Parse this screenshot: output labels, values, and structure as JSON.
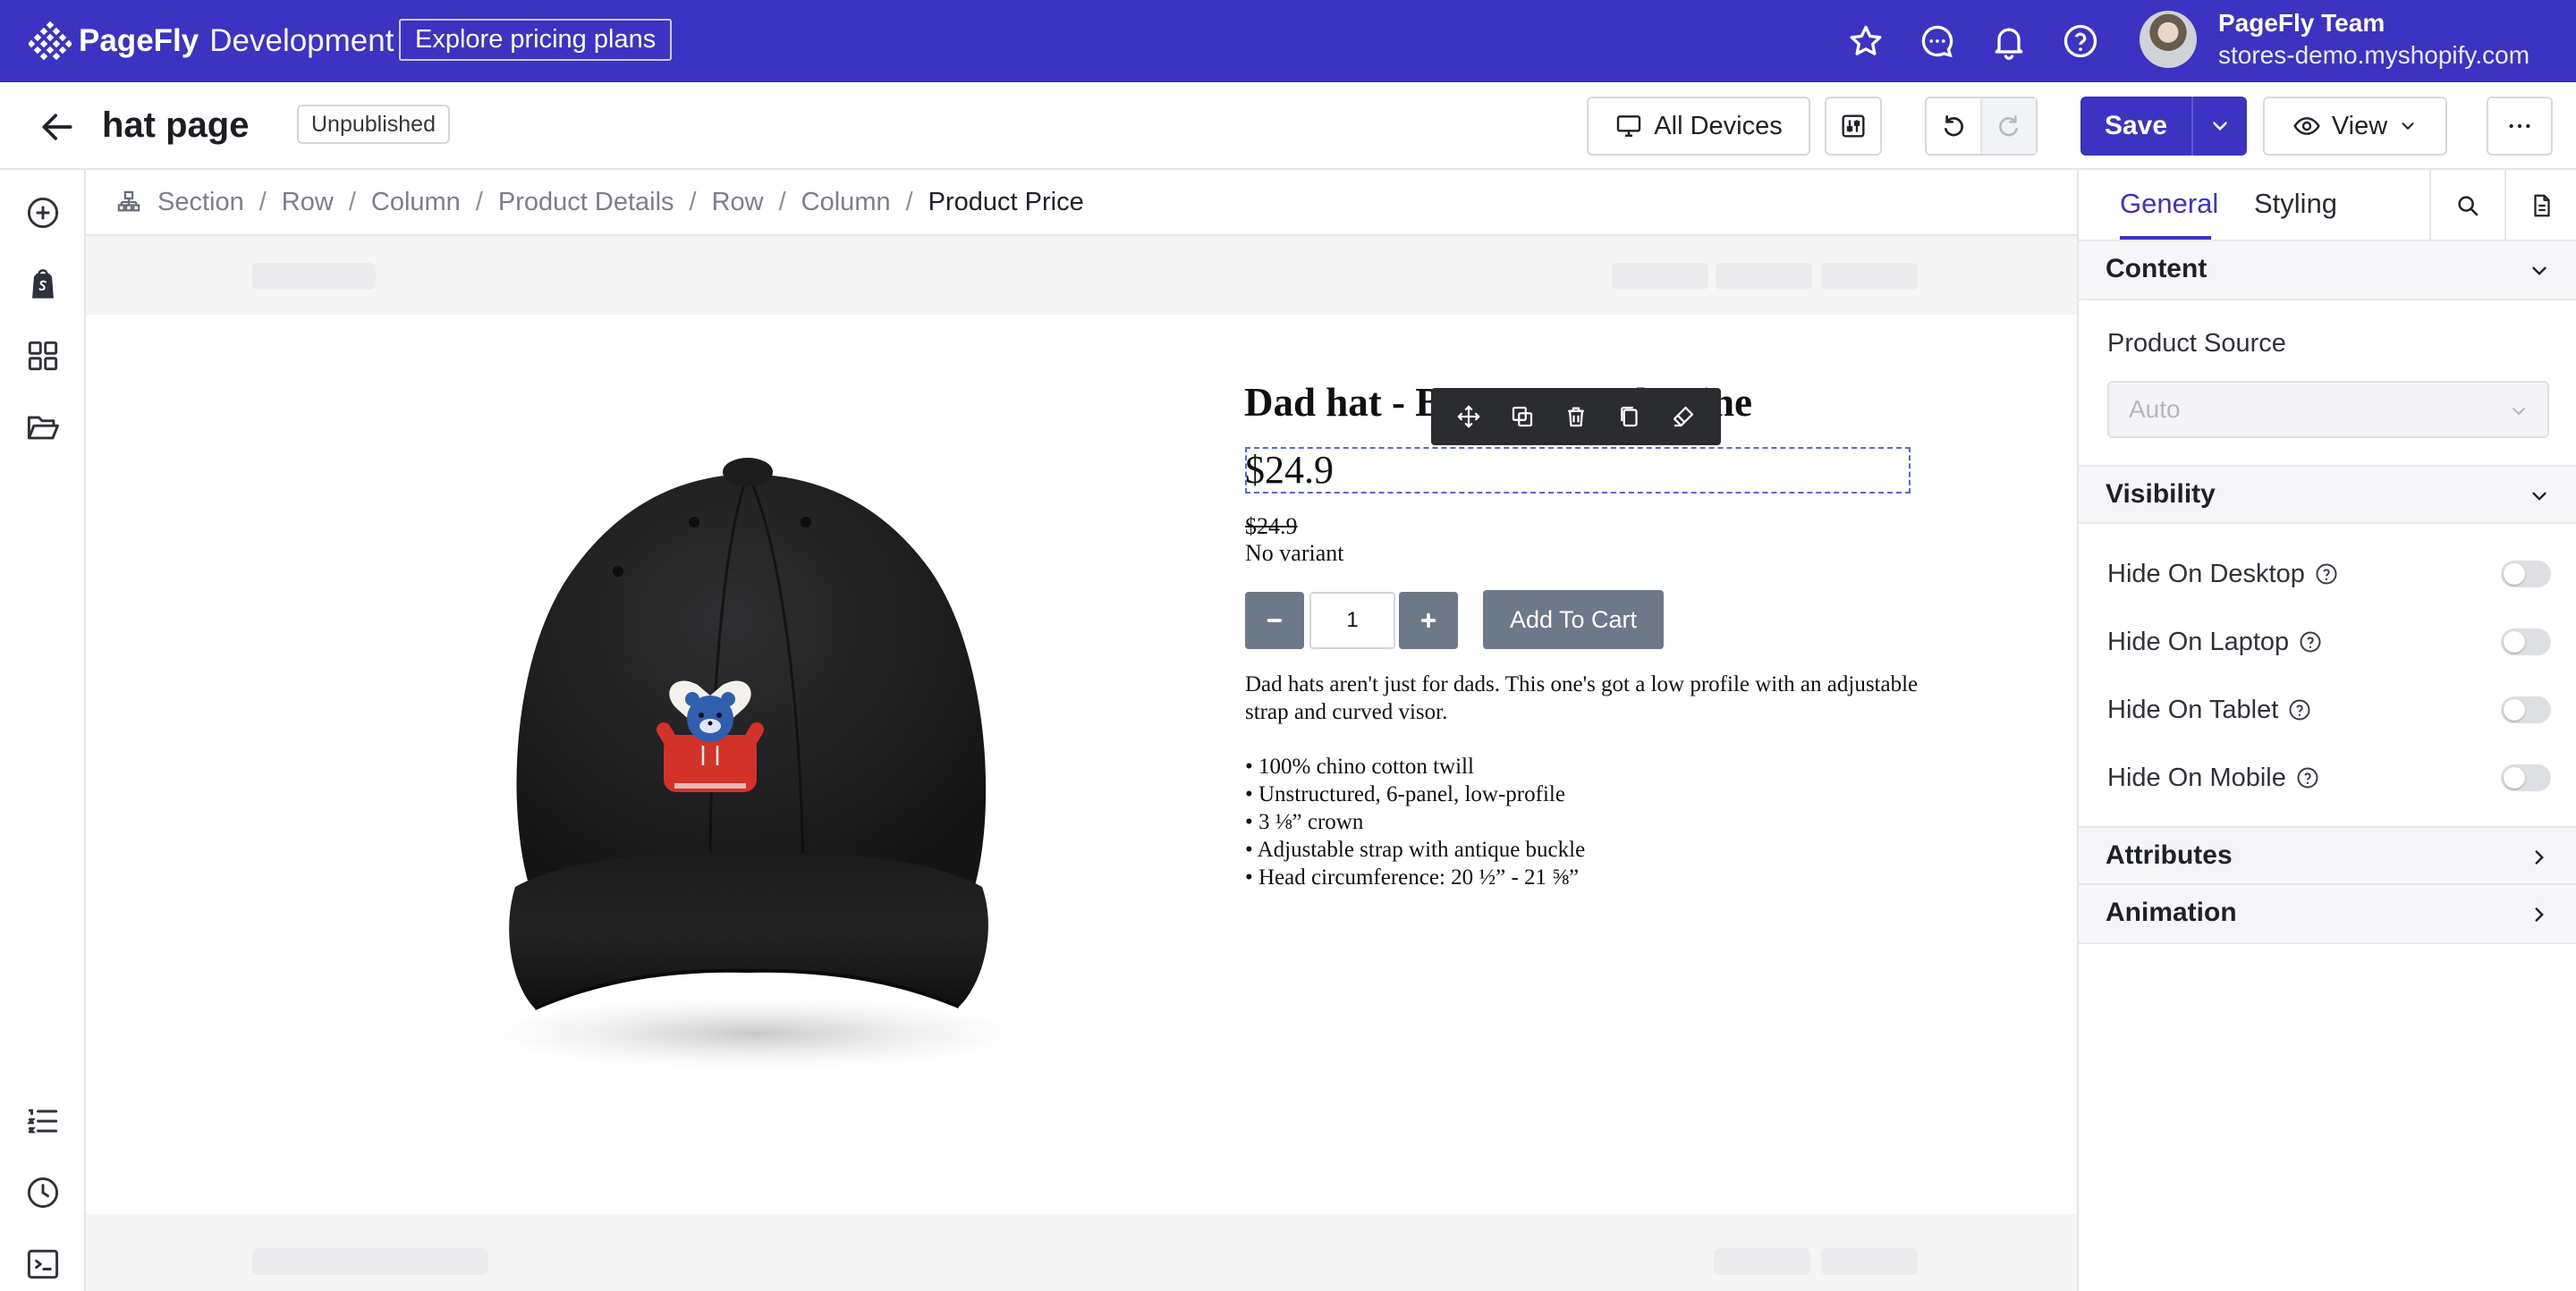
{
  "topbar": {
    "brand_name": "PageFly",
    "brand_env": "Development",
    "explore_label": "Explore pricing plans",
    "icons": [
      "star-icon",
      "chat-icon",
      "bell-icon",
      "help-icon"
    ],
    "user_name": "PageFly Team",
    "store_url": "stores-demo.myshopify.com",
    "brand_color": "#3c33c3"
  },
  "toolbar": {
    "page_title": "hat page",
    "status": "Unpublished",
    "devices_label": "All Devices",
    "save_label": "Save",
    "view_label": "View"
  },
  "left_rail": {
    "top_icons": [
      "add-element-icon",
      "shopify-icon",
      "layout-grid-icon",
      "folder-icon"
    ],
    "bottom_icons": [
      "list-icon",
      "history-icon",
      "code-icon"
    ]
  },
  "breadcrumb": {
    "items": [
      "Section",
      "Row",
      "Column",
      "Product Details",
      "Row",
      "Column"
    ],
    "current": "Product Price",
    "separator": "/"
  },
  "product": {
    "title": "Dad hat - Bear Hug Valentine",
    "price": "$24.9",
    "compare_price": "$24.9",
    "variant": "No variant",
    "quantity": "1",
    "minus_label": "−",
    "plus_label": "+",
    "add_to_cart": "Add To Cart",
    "description": "Dad hats aren't just for dads. This one's got a low profile with an adjustable strap and curved visor.",
    "features": [
      "• 100% chino cotton twill",
      "• Unstructured, 6-panel, low-profile",
      "• 3 ⅛” crown",
      "• Adjustable strap with antique buckle",
      "• Head circumference: 20 ½” - 21 ⅝”"
    ]
  },
  "element_toolbar": {
    "icons": [
      "move-icon",
      "duplicate-icon",
      "trash-icon",
      "copy-icon",
      "paint-icon"
    ]
  },
  "panel": {
    "tabs": [
      "General",
      "Styling"
    ],
    "active_tab": "General",
    "content_title": "Content",
    "product_source_label": "Product Source",
    "product_source_value": "Auto",
    "visibility_title": "Visibility",
    "visibility_options": [
      {
        "label": "Hide On Desktop",
        "on": false
      },
      {
        "label": "Hide On Laptop",
        "on": false
      },
      {
        "label": "Hide On Tablet",
        "on": false
      },
      {
        "label": "Hide On Mobile",
        "on": false
      }
    ],
    "attributes_title": "Attributes",
    "animation_title": "Animation"
  }
}
